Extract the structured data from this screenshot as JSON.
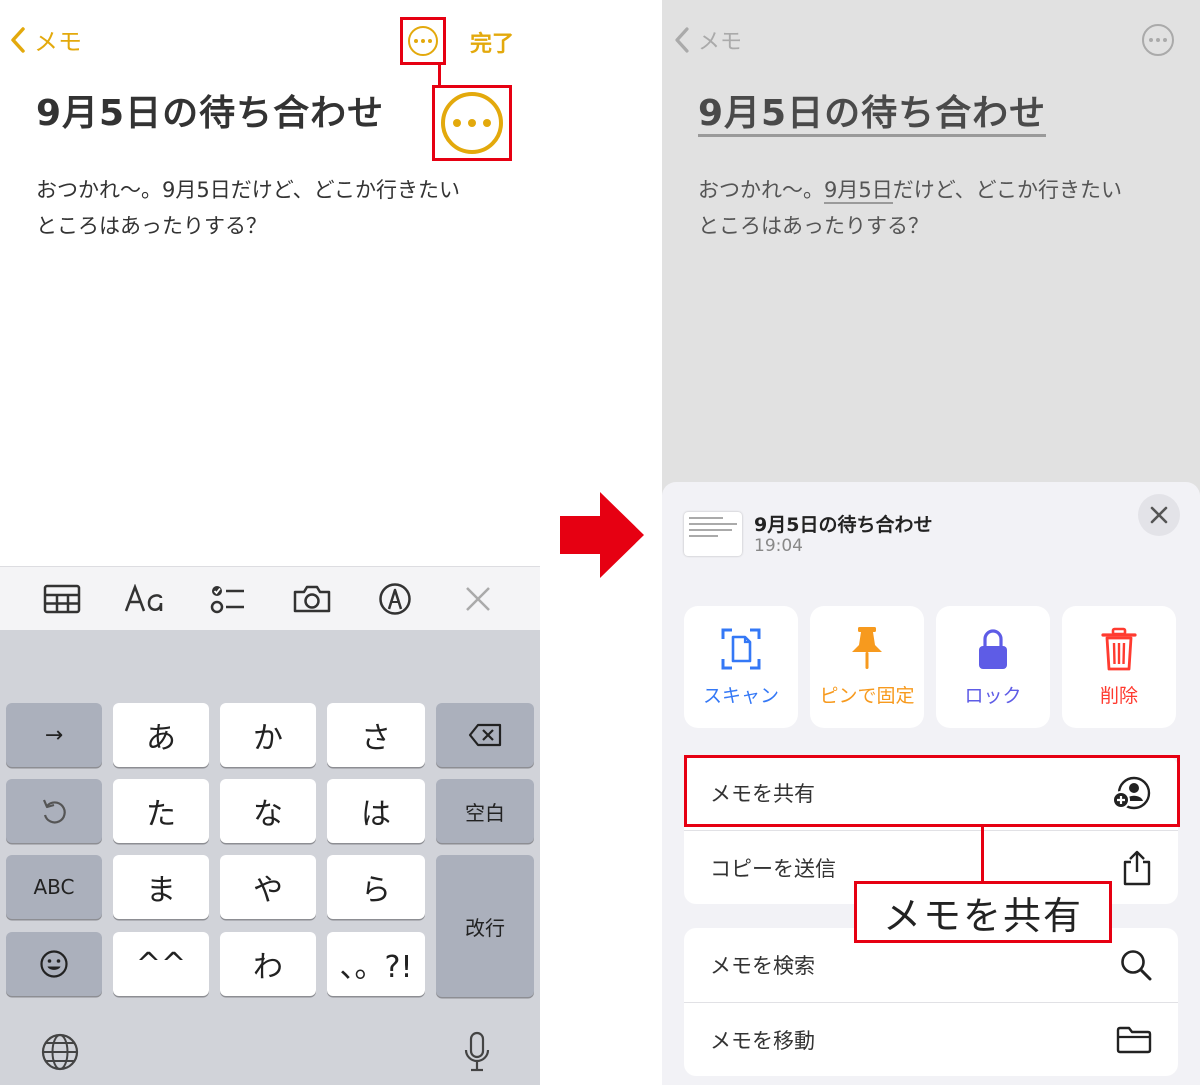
{
  "left_screen": {
    "nav": {
      "back_label": "メモ",
      "done_label": "完了"
    },
    "note": {
      "title": "9月5日の待ち合わせ",
      "body_line1": "おつかれ〜。9月5日だけど、どこか行きたい",
      "body_line2": "ところはあったりする？"
    },
    "keyboard": {
      "row1": [
        "→",
        "あ",
        "か",
        "さ"
      ],
      "row2": [
        "た",
        "な",
        "は",
        "空白"
      ],
      "row3": [
        "ABC",
        "ま",
        "や",
        "ら",
        "改行"
      ],
      "row4": [
        "^^",
        "わ",
        "、。?!"
      ]
    }
  },
  "right_screen": {
    "nav": {
      "back_label": "メモ"
    },
    "note": {
      "title": "9月5日の待ち合わせ",
      "body_pre": "おつかれ〜。",
      "body_link": "9月5日",
      "body_post": "だけど、どこか行きたい",
      "body_line2": "ところはあったりする？"
    },
    "sheet": {
      "title": "9月5日の待ち合わせ",
      "time": "19:04",
      "quick_actions": [
        {
          "label": "スキャン",
          "icon": "scan-document-icon",
          "color": "#3478f6"
        },
        {
          "label": "ピンで固定",
          "icon": "pin-icon",
          "color": "#f79a1e"
        },
        {
          "label": "ロック",
          "icon": "lock-icon",
          "color": "#5e5ce6"
        },
        {
          "label": "削除",
          "icon": "trash-icon",
          "color": "#ff3b30"
        }
      ],
      "group1": [
        {
          "label": "メモを共有",
          "icon": "person-add-icon"
        },
        {
          "label": "コピーを送信",
          "icon": "share-icon"
        }
      ],
      "group2": [
        {
          "label": "メモを検索",
          "icon": "search-icon"
        },
        {
          "label": "メモを移動",
          "icon": "folder-icon"
        }
      ]
    }
  },
  "annotation": {
    "callout_text": "メモを共有"
  },
  "colors": {
    "accent": "#e3a90c",
    "highlight": "#e60012"
  }
}
